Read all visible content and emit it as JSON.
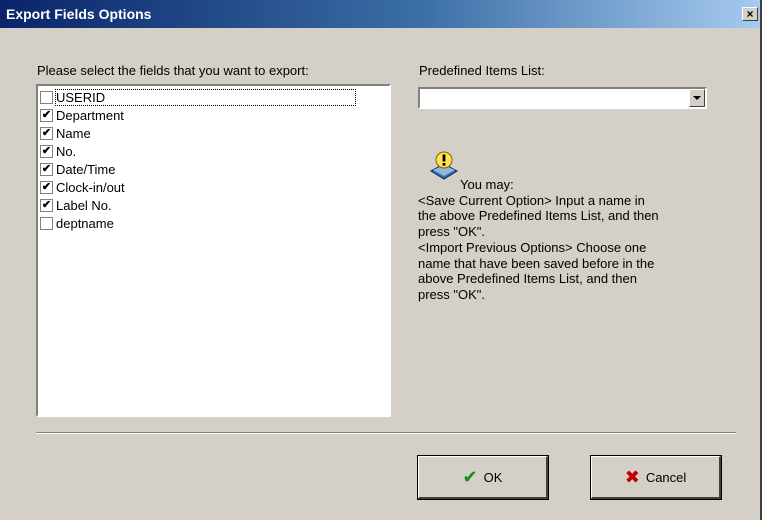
{
  "window": {
    "title": "Export Fields Options",
    "close": "×"
  },
  "fields": {
    "label": "Please select the fields that you want to export:",
    "items": [
      {
        "label": "USERID",
        "checked": false
      },
      {
        "label": "Department",
        "checked": true
      },
      {
        "label": "Name",
        "checked": true
      },
      {
        "label": "No.",
        "checked": true
      },
      {
        "label": "Date/Time",
        "checked": true
      },
      {
        "label": "Clock-in/out",
        "checked": true
      },
      {
        "label": "Label No.",
        "checked": true
      },
      {
        "label": "deptname",
        "checked": false
      }
    ]
  },
  "predefined": {
    "label": "Predefined Items List:",
    "value": ""
  },
  "help": {
    "lines": [
      "You may:",
      "<Save Current Option> Input a name in",
      "the above Predefined Items List, and then",
      "press \"OK\".",
      "<Import Previous Options> Choose one",
      "name that have been saved before in the",
      "above Predefined Items List, and then",
      "press \"OK\"."
    ]
  },
  "buttons": {
    "ok": "OK",
    "cancel": "Cancel"
  },
  "colors": {
    "title_start": "#0a246a",
    "title_end": "#a6caf0",
    "face": "#d4d0c8"
  }
}
